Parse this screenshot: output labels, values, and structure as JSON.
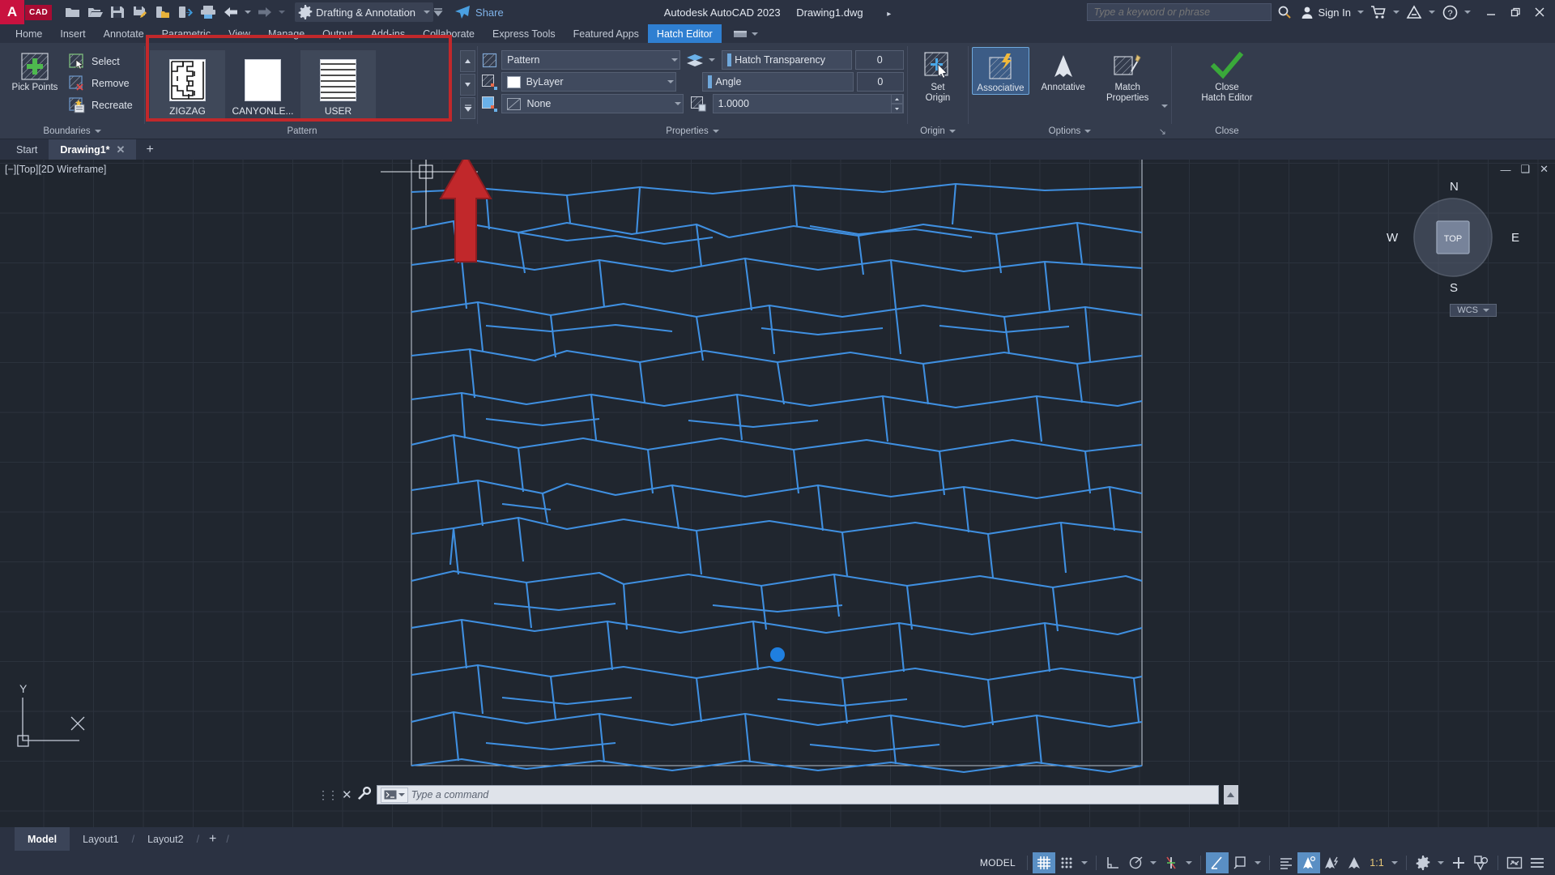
{
  "titlebar": {
    "logo_text": "A",
    "logo_sub": "CAD",
    "quick_access": [
      {
        "name": "new-file-icon",
        "label": "New"
      },
      {
        "name": "open-file-icon",
        "label": "Open"
      },
      {
        "name": "save-icon",
        "label": "Save"
      },
      {
        "name": "save-as-icon",
        "label": "Save As"
      },
      {
        "name": "open-from-web-icon",
        "label": "Open from Web & Mobile"
      },
      {
        "name": "save-to-web-icon",
        "label": "Save to Web & Mobile"
      },
      {
        "name": "plot-icon",
        "label": "Plot"
      },
      {
        "name": "undo-icon",
        "label": "Undo"
      },
      {
        "name": "redo-icon",
        "label": "Redo"
      }
    ],
    "workspace": "Drafting & Annotation",
    "share_label": "Share",
    "app_title": "Autodesk AutoCAD 2023",
    "document_title": "Drawing1.dwg",
    "search_placeholder": "Type a keyword or phrase",
    "search_value": "",
    "sign_in_label": "Sign In",
    "window_buttons": [
      "minimize",
      "restore",
      "close"
    ]
  },
  "ribbon_tabs": [
    {
      "label": "Home",
      "active": false
    },
    {
      "label": "Insert",
      "active": false
    },
    {
      "label": "Annotate",
      "active": false
    },
    {
      "label": "Parametric",
      "active": false
    },
    {
      "label": "View",
      "active": false
    },
    {
      "label": "Manage",
      "active": false
    },
    {
      "label": "Output",
      "active": false
    },
    {
      "label": "Add-ins",
      "active": false
    },
    {
      "label": "Collaborate",
      "active": false
    },
    {
      "label": "Express Tools",
      "active": false
    },
    {
      "label": "Featured Apps",
      "active": false
    },
    {
      "label": "Hatch Editor",
      "active": true
    }
  ],
  "ribbon": {
    "boundaries": {
      "title": "Boundaries",
      "pick_points": "Pick Points",
      "select": "Select",
      "remove": "Remove",
      "recreate": "Recreate"
    },
    "pattern": {
      "title": "Pattern",
      "highlighted": true,
      "highlight_color": "#c1282b",
      "items": [
        {
          "label": "ZIGZAG",
          "swatch": "zigzag",
          "selected": false
        },
        {
          "label": "CANYONLE...",
          "swatch": "solid",
          "selected": true
        },
        {
          "label": "USER",
          "swatch": "lines",
          "selected": false
        }
      ]
    },
    "properties": {
      "title": "Properties",
      "hatch_type": "Pattern",
      "hatch_color": "ByLayer",
      "background_color": "None",
      "hatch_layer_icon": "layers-icon",
      "transparency_label": "Hatch Transparency",
      "transparency_value": "0",
      "angle_label": "Angle",
      "angle_value": "0",
      "scale_value": "1.0000"
    },
    "origin": {
      "title": "Origin",
      "set_origin": "Set\nOrigin",
      "set_origin_line1": "Set",
      "set_origin_line2": "Origin"
    },
    "options": {
      "title": "Options",
      "associative": "Associative",
      "associative_on": true,
      "annotative": "Annotative",
      "match_properties_line1": "Match",
      "match_properties_line2": "Properties"
    },
    "close": {
      "title": "Close",
      "line1": "Close",
      "line2": "Hatch Editor"
    }
  },
  "file_tabs": [
    {
      "label": "Start",
      "active": false,
      "closable": false
    },
    {
      "label": "Drawing1*",
      "active": true,
      "closable": true
    }
  ],
  "canvas": {
    "viewport_label": "[−][Top][2D Wireframe]",
    "viewcube_top": "TOP",
    "viewcube_n": "N",
    "viewcube_e": "E",
    "viewcube_s": "S",
    "viewcube_w": "W",
    "wcs_label": "WCS",
    "ucs_x": "X",
    "ucs_y": "Y",
    "minimize_icon": "minimize-viewport-icon",
    "maximize_icon": "maximize-viewport-icon",
    "close_icon": "close-viewport-icon",
    "pick_point_marker_color": "#1f7fe0"
  },
  "command_line": {
    "placeholder": "Type a command",
    "value": "",
    "prefix_icon": "command-prompt-icon",
    "close_icon": "close-icon",
    "customize_icon": "wrench-icon",
    "grip_icon": "drag-handle-icon"
  },
  "layout_tabs": [
    {
      "label": "Model",
      "active": true
    },
    {
      "label": "Layout1",
      "active": false
    },
    {
      "label": "Layout2",
      "active": false
    }
  ],
  "layout_add_label": "+",
  "statusbar": {
    "model_label": "MODEL",
    "scale_label": "1:1",
    "buttons": [
      {
        "name": "grid-display-toggle",
        "icon": "grid-icon",
        "on": true
      },
      {
        "name": "snap-mode-toggle",
        "icon": "snap-dots-icon",
        "on": false
      },
      {
        "name": "ortho-mode-toggle",
        "icon": "ortho-icon",
        "on": false
      },
      {
        "name": "polar-tracking-toggle",
        "icon": "polar-icon",
        "on": false
      },
      {
        "name": "object-snap-toggle",
        "icon": "osnap-icon",
        "on": false
      },
      {
        "name": "object-snap-tracking-toggle",
        "icon": "otrack-icon",
        "on": true
      },
      {
        "name": "ucs-icon-toggle",
        "icon": "ucs-box-icon",
        "on": false
      },
      {
        "name": "lineweight-toggle",
        "icon": "lineweight-icon",
        "on": false
      },
      {
        "name": "transparency-toggle",
        "icon": "transparency-icon",
        "on": true
      },
      {
        "name": "selection-cycling-toggle",
        "icon": "selection-cycling-icon",
        "on": false
      },
      {
        "name": "annotation-visibility-toggle",
        "icon": "annotation-visibility-icon",
        "on": false
      },
      {
        "name": "workspace-switching",
        "icon": "gear-icon",
        "on": false
      },
      {
        "name": "hardware-acceleration",
        "icon": "plus-icon",
        "on": false
      },
      {
        "name": "isolate-objects",
        "icon": "isolate-icon",
        "on": false
      },
      {
        "name": "clean-screen",
        "icon": "clean-screen-icon",
        "on": false
      },
      {
        "name": "customization",
        "icon": "hamburger-icon",
        "on": false
      }
    ]
  },
  "colors": {
    "accent": "#2f7fd1",
    "highlight_red": "#c1282b",
    "hatch_blue": "#3f8fe0",
    "canvas_bg": "#20262f",
    "chrome_bg": "#2b3242",
    "ribbon_bg": "#343c4d"
  }
}
